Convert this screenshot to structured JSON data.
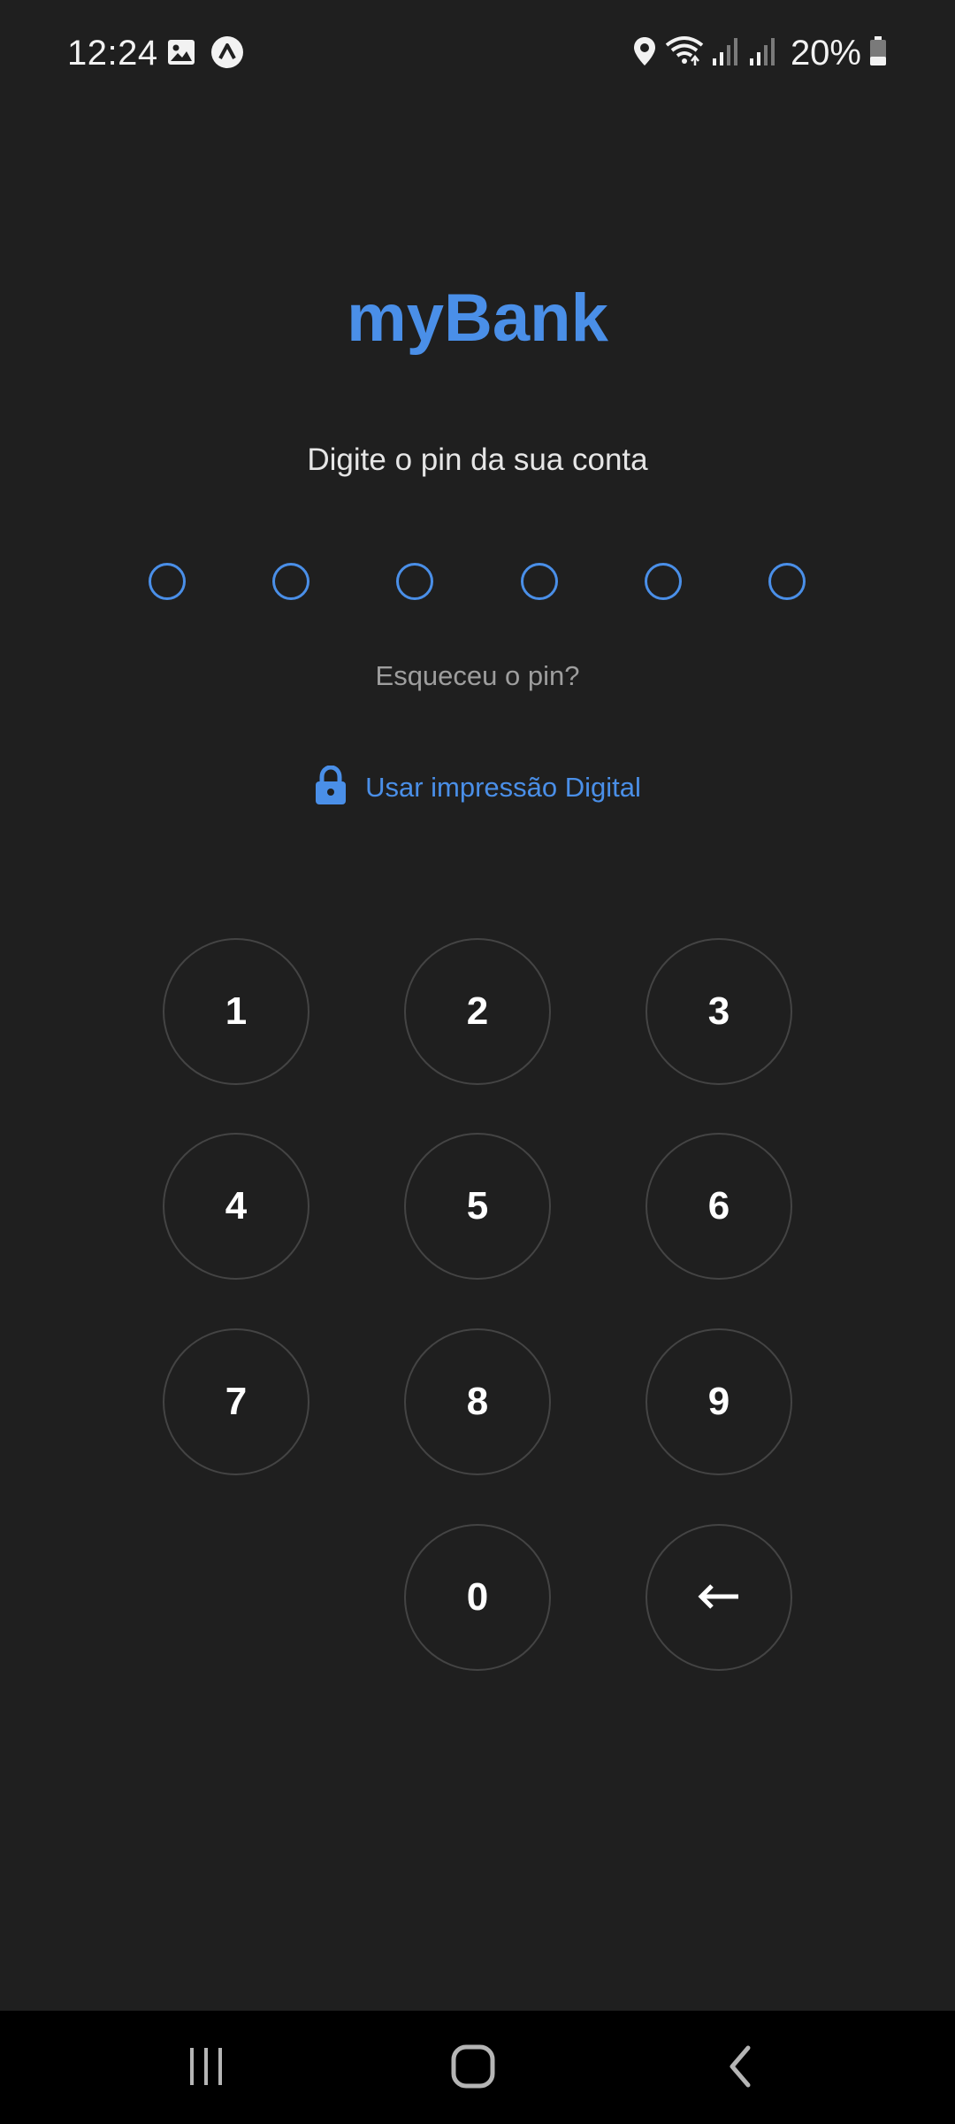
{
  "status_bar": {
    "time": "12:24",
    "battery": "20%",
    "icons_left": [
      "image-icon",
      "app-notification-icon"
    ],
    "icons_right": [
      "location-icon",
      "wifi-icon",
      "signal-icon",
      "signal-icon",
      "battery-icon"
    ]
  },
  "app": {
    "title": "myBank",
    "prompt": "Digite o pin da sua conta",
    "pin_length": 6,
    "pin_entered": 0,
    "forgot_pin": "Esqueceu o pin?",
    "fingerprint_label": "Usar impressão Digital",
    "fingerprint_icon": "lock-icon"
  },
  "keypad": {
    "keys": [
      "1",
      "2",
      "3",
      "4",
      "5",
      "6",
      "7",
      "8",
      "9",
      "0"
    ],
    "backspace_icon": "backspace-arrow-icon"
  },
  "nav_bar": {
    "buttons": [
      "recent-apps-icon",
      "home-icon",
      "back-icon"
    ]
  },
  "colors": {
    "background": "#1f1f1f",
    "accent": "#4a8fe8",
    "key_border": "#444444",
    "secondary_text": "#9e9e9e",
    "nav_background": "#000000"
  }
}
